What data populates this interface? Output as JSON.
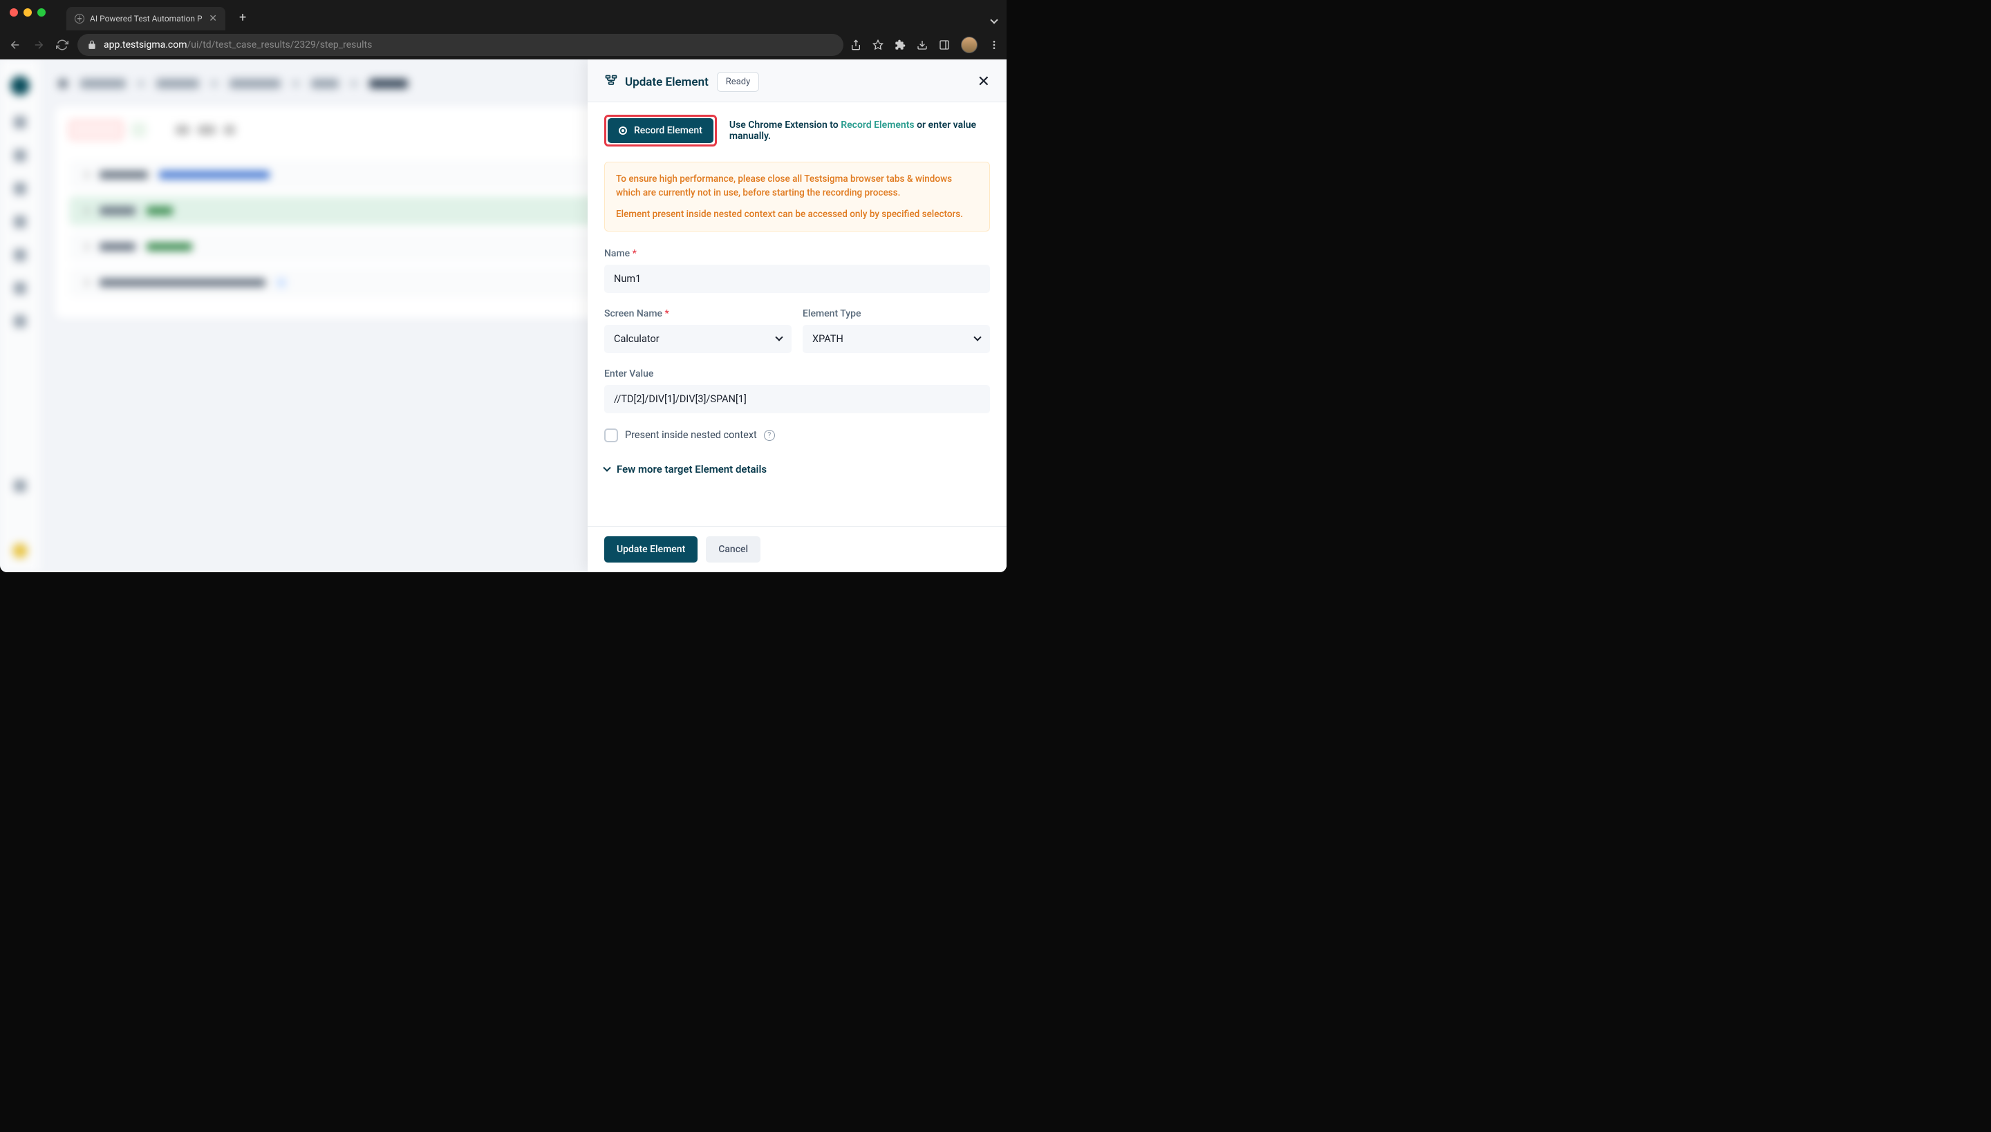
{
  "browser": {
    "tab_title": "AI Powered Test Automation P",
    "url_domain": "app.testsigma.com",
    "url_path": "/ui/td/test_case_results/2329/step_results"
  },
  "panel": {
    "title": "Update Element",
    "ready_label": "Ready",
    "record_button": "Record Element",
    "ext_text_prefix": "Use Chrome Extension to ",
    "ext_link": "Record Elements",
    "ext_text_suffix": " or enter value manually.",
    "warning_line1": "To ensure high performance, please close all Testsigma browser tabs & windows which are currently not in use, before starting the recording process.",
    "warning_line2": "Element present inside nested context can be accessed only by specified selectors.",
    "labels": {
      "name": "Name",
      "screen_name": "Screen Name",
      "element_type": "Element Type",
      "enter_value": "Enter Value"
    },
    "values": {
      "name": "Num1",
      "screen_name": "Calculator",
      "element_type": "XPATH",
      "enter_value": "//TD[2]/DIV[1]/DIV[3]/SPAN[1]"
    },
    "checkbox_label": "Present inside nested context",
    "expand_label": "Few more target Element details",
    "footer": {
      "update": "Update Element",
      "cancel": "Cancel"
    }
  }
}
